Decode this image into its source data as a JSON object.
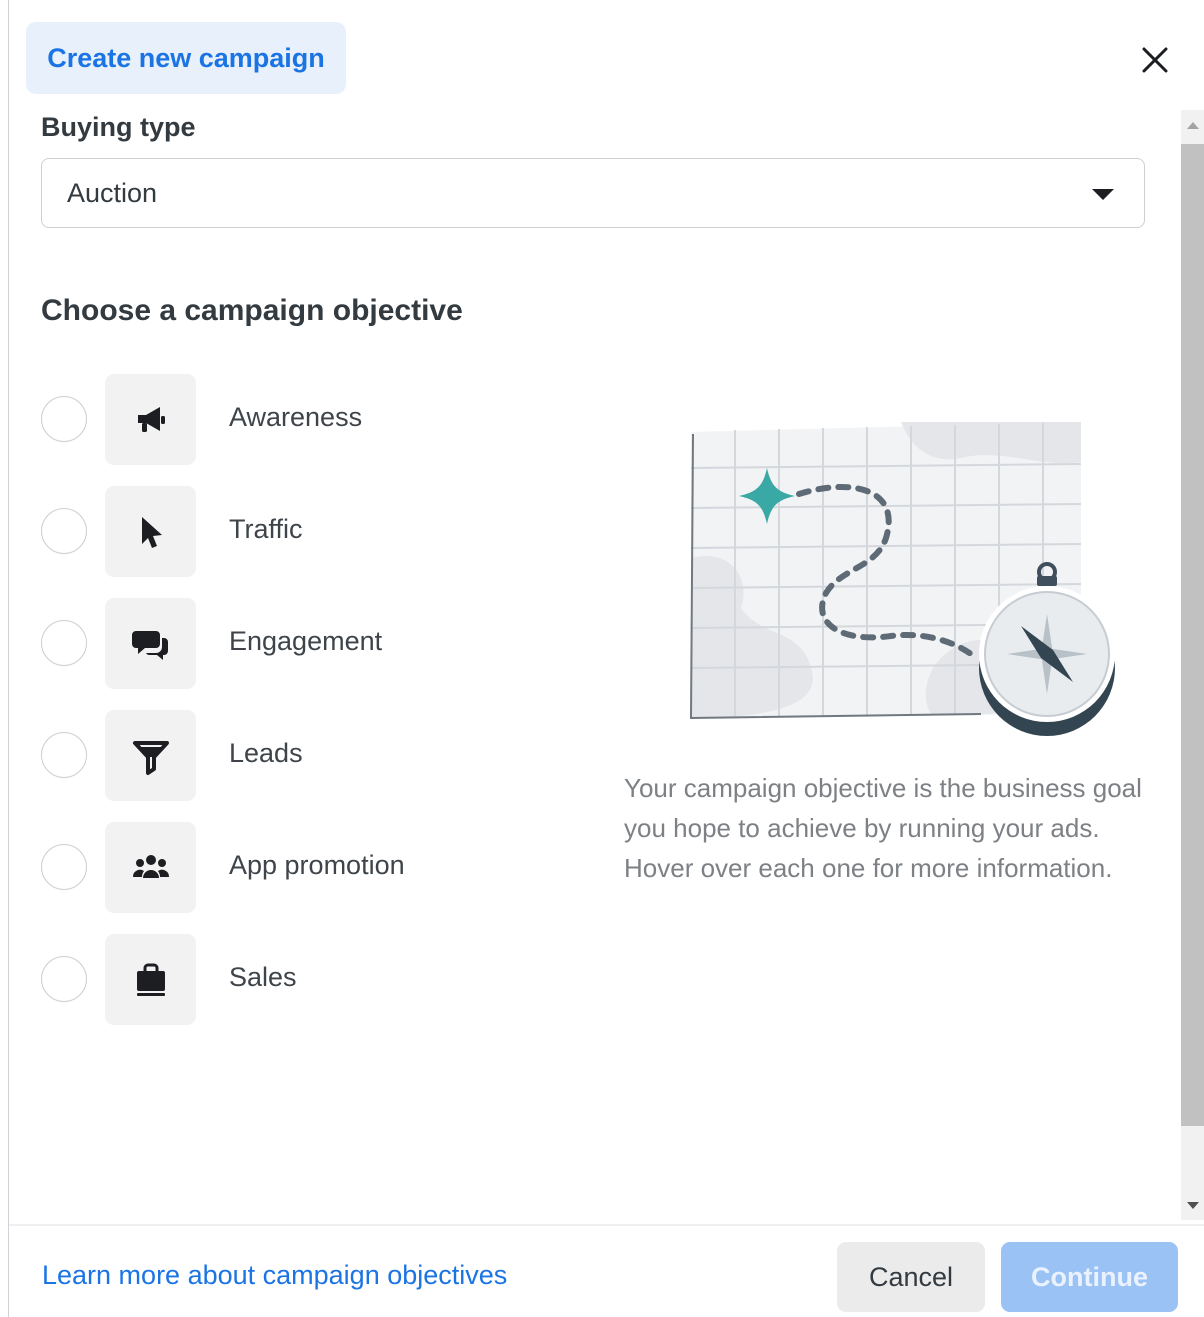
{
  "header": {
    "title": "Create new campaign",
    "close_icon": "close-icon"
  },
  "buying_type": {
    "label": "Buying type",
    "selected": "Auction"
  },
  "objectives": {
    "heading": "Choose a campaign objective",
    "items": [
      {
        "label": "Awareness",
        "icon": "megaphone-icon"
      },
      {
        "label": "Traffic",
        "icon": "cursor-icon"
      },
      {
        "label": "Engagement",
        "icon": "chat-bubbles-icon"
      },
      {
        "label": "Leads",
        "icon": "funnel-icon"
      },
      {
        "label": "App promotion",
        "icon": "people-group-icon"
      },
      {
        "label": "Sales",
        "icon": "shopping-bag-icon"
      }
    ]
  },
  "description": "Your campaign objective is the business goal you hope to achieve by running your ads. Hover over each one for more information.",
  "footer": {
    "learn_more": "Learn more about campaign objectives",
    "cancel": "Cancel",
    "continue": "Continue"
  },
  "colors": {
    "accent": "#1b74e4",
    "tab_bg": "#e7f0fb",
    "continue_disabled": "#9ac2f5",
    "illustration_teal": "#3aa8a4"
  }
}
